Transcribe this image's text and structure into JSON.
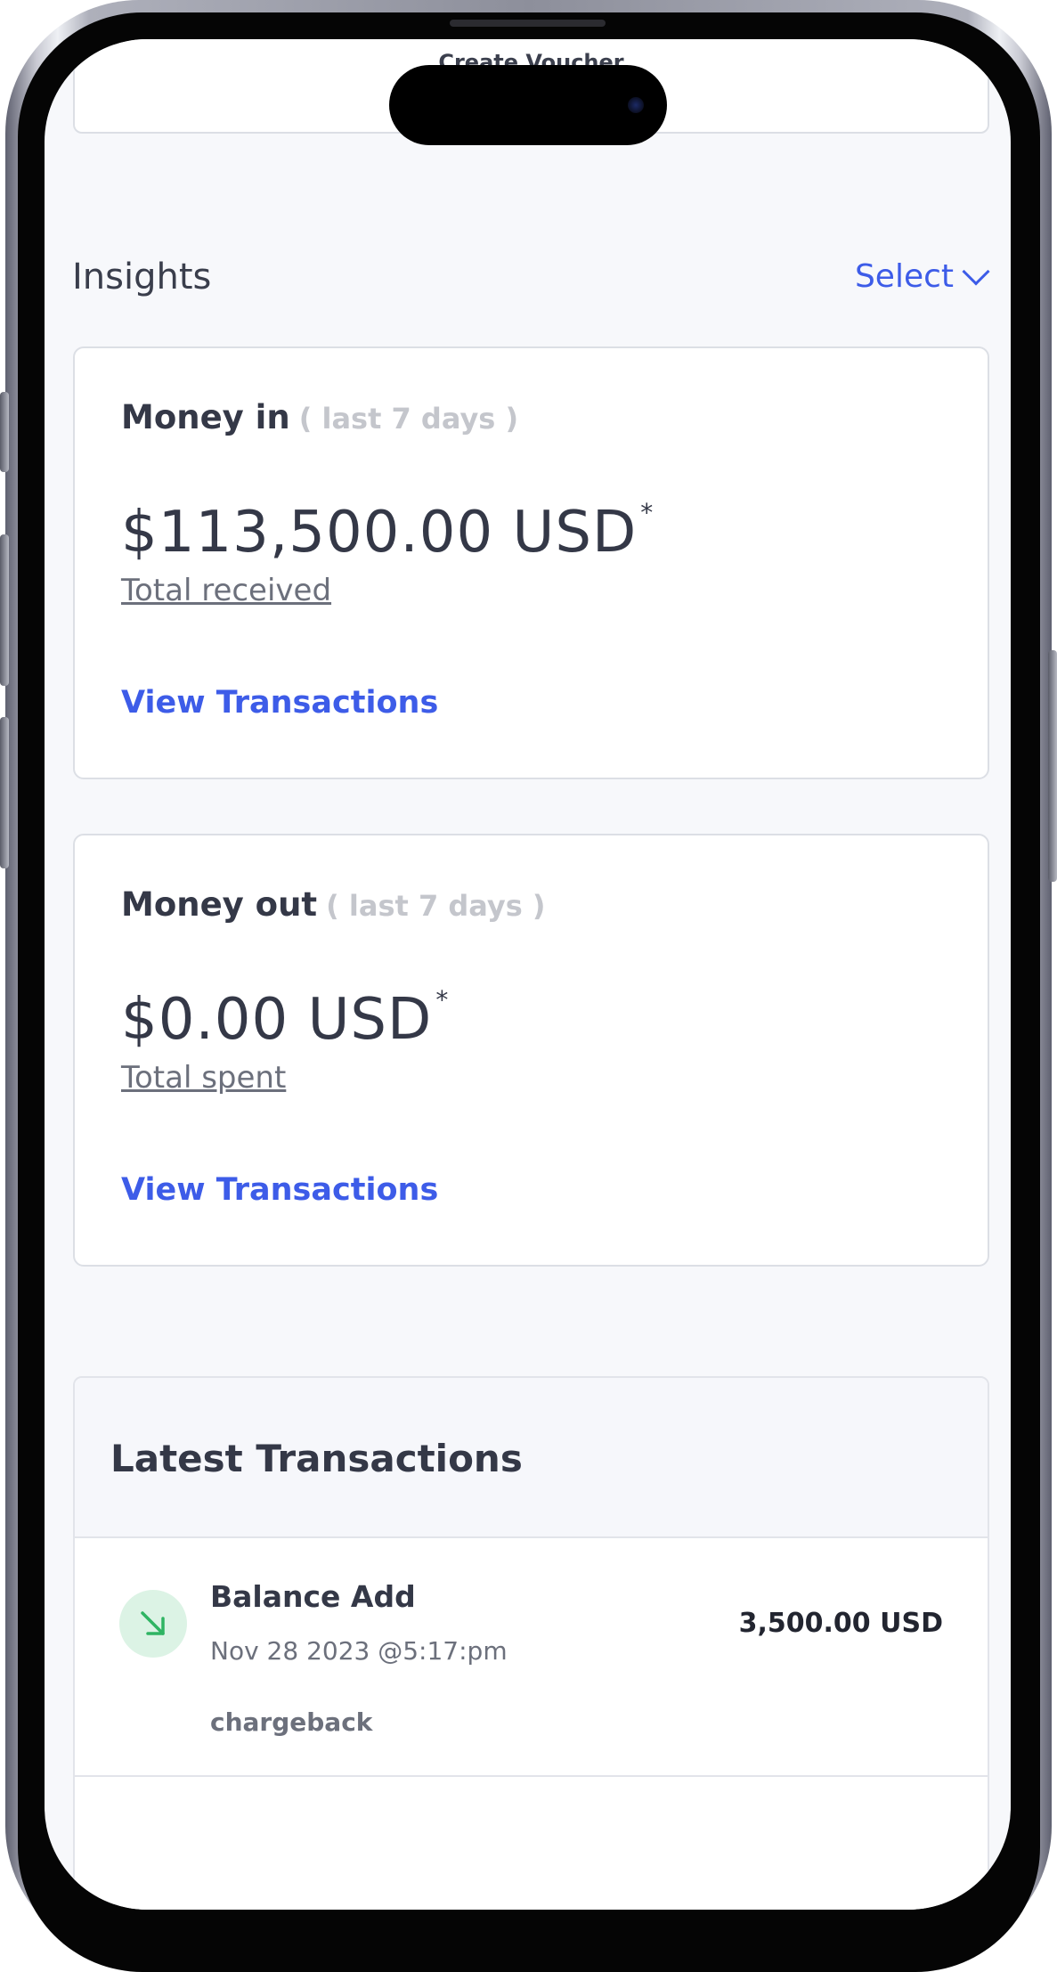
{
  "voucher": {
    "label": "Create Voucher"
  },
  "insights": {
    "title": "Insights",
    "select_label": "Select"
  },
  "money_in": {
    "heading": "Money in",
    "period": "( last 7 days )",
    "amount": "$113,500.00 USD",
    "footnote": "*",
    "label": "Total received",
    "link": "View Transactions"
  },
  "money_out": {
    "heading": "Money out",
    "period": "( last 7 days )",
    "amount": "$0.00 USD",
    "footnote": "*",
    "label": "Total spent",
    "link": "View Transactions"
  },
  "latest": {
    "title": "Latest Transactions",
    "items": [
      {
        "title": "Balance Add",
        "date": "Nov 28 2023 @5:17:pm",
        "note": "chargeback",
        "amount": "3,500.00 USD",
        "icon": "arrow-down-right-icon"
      }
    ]
  },
  "colors": {
    "accent": "#3d5ce8",
    "text": "#343847",
    "muted": "#6c707c",
    "success_bg": "#dcf3e5",
    "success": "#2fb463"
  }
}
